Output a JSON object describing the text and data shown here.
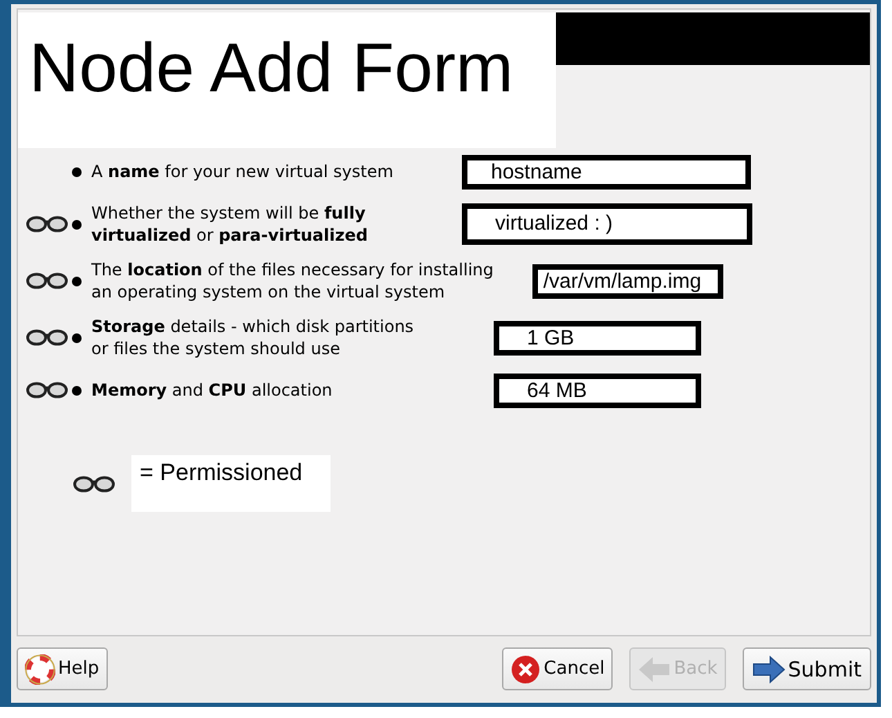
{
  "title": "Node Add Form",
  "rows": [
    {
      "permissioned": false,
      "label": "A **name** for your new virtual system",
      "value": "hostname"
    },
    {
      "permissioned": true,
      "label": "Whether the system will be **fully**\n**virtualized** or **para-virtualized**",
      "value": "virtualized : )"
    },
    {
      "permissioned": true,
      "label": "The **location** of the files necessary for installing\nan operating system on the virtual system",
      "value": "/var/vm/lamp.img"
    },
    {
      "permissioned": true,
      "label": "**Storage** details - which disk partitions\nor files the system should use",
      "value": "1 GB"
    },
    {
      "permissioned": true,
      "label": "**Memory** and **CPU** allocation",
      "value": "64 MB"
    }
  ],
  "legend": "= Permissioned",
  "buttons": [
    {
      "kind": "help",
      "label": "Help",
      "disabled": false
    },
    {
      "kind": "cancel",
      "label": "Cancel",
      "disabled": false
    },
    {
      "kind": "back",
      "label": "Back",
      "disabled": true
    },
    {
      "kind": "submit",
      "label": "Submit",
      "disabled": false
    }
  ]
}
